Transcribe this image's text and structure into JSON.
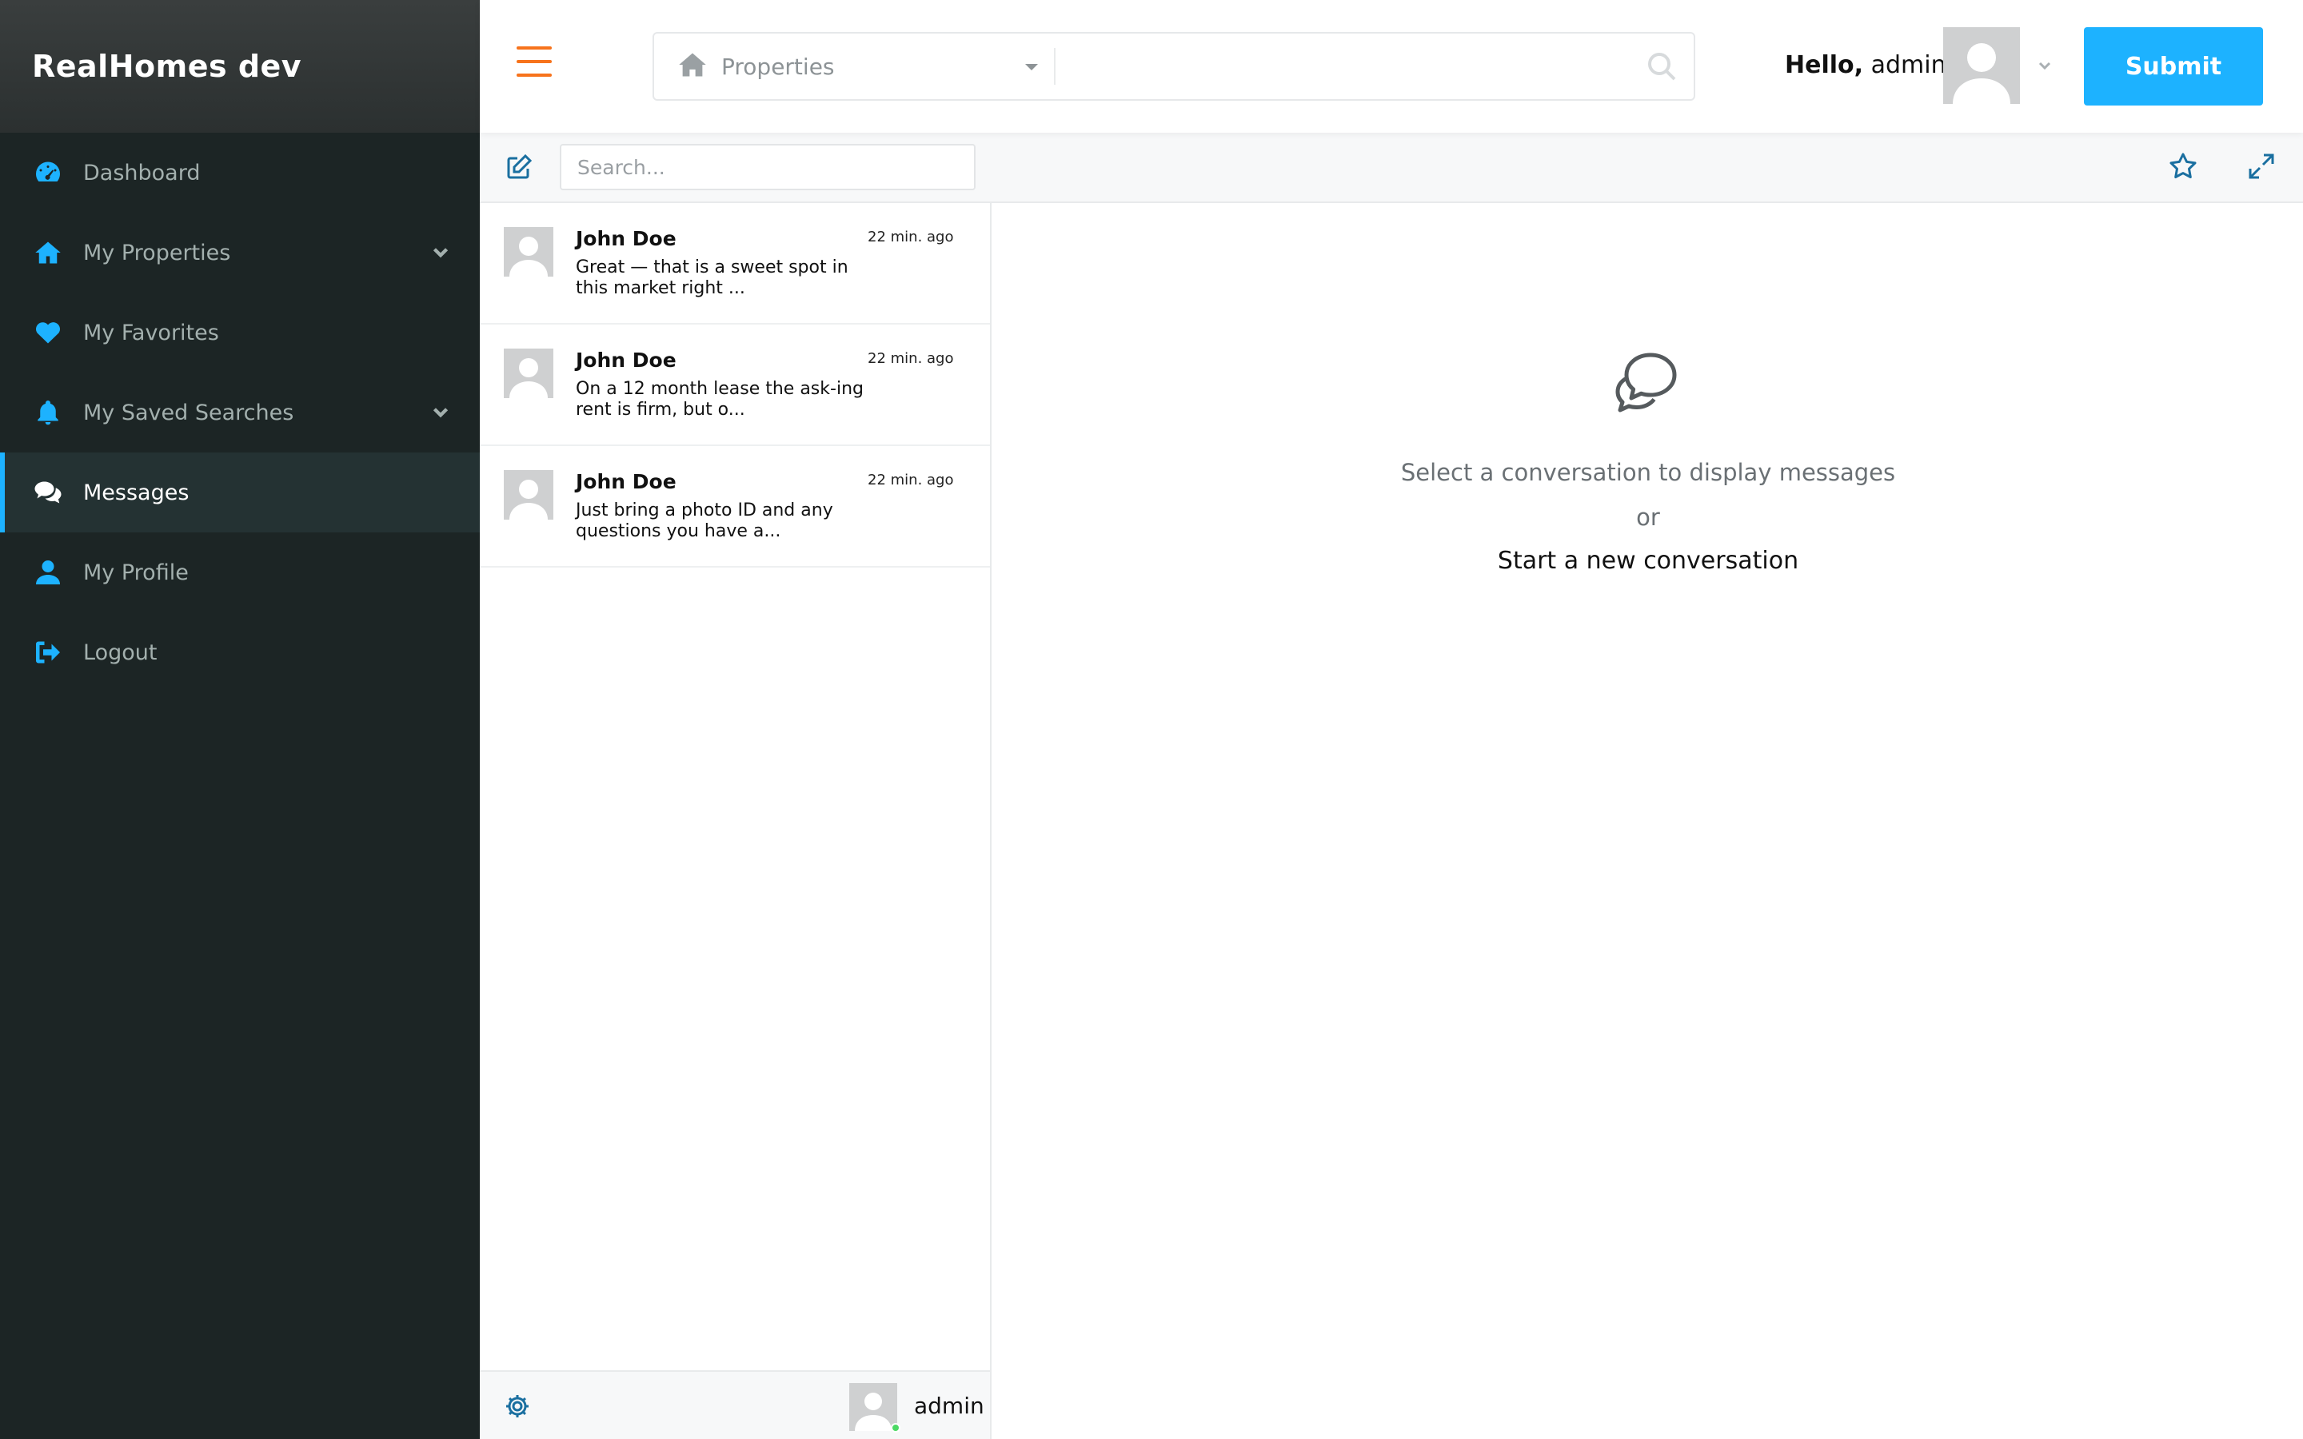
{
  "brand": {
    "title": "RealHomes dev"
  },
  "sidebar": {
    "items": [
      {
        "label": "Dashboard",
        "icon": "dashboard-gauge-icon"
      },
      {
        "label": "My Properties",
        "icon": "home-icon",
        "has_submenu": true
      },
      {
        "label": "My Favorites",
        "icon": "heart-icon"
      },
      {
        "label": "My Saved Searches",
        "icon": "bell-icon",
        "has_submenu": true
      },
      {
        "label": "Messages",
        "icon": "chat-bubbles-icon",
        "active": true
      },
      {
        "label": "My Profile",
        "icon": "user-icon"
      },
      {
        "label": "Logout",
        "icon": "logout-icon"
      }
    ]
  },
  "header": {
    "search": {
      "type_label": "Properties",
      "keyword_value": ""
    },
    "greeting_bold": "Hello,",
    "username": "admin",
    "submit_label": "Submit"
  },
  "messages": {
    "search_placeholder": "Search...",
    "conversations": [
      {
        "name": "John Doe",
        "time": "22 min. ago",
        "preview": "Great — that is a sweet spot in this market right ..."
      },
      {
        "name": "John Doe",
        "time": "22 min. ago",
        "preview": "On a 12 month lease the ask-ing rent is firm, but o..."
      },
      {
        "name": "John Doe",
        "time": "22 min. ago",
        "preview": "Just bring a photo ID and any questions you have a..."
      }
    ],
    "footer_user": "admin",
    "empty_state": {
      "line1": "Select a conversation to display messages",
      "or": "or",
      "link": "Start a new conversation"
    }
  },
  "colors": {
    "accent": "#1db2ff",
    "menu_icon": "#f7731c",
    "sidebar_bg": "#1c2525",
    "toolbar_icon": "#1a6fa0",
    "online": "#4cd964"
  }
}
